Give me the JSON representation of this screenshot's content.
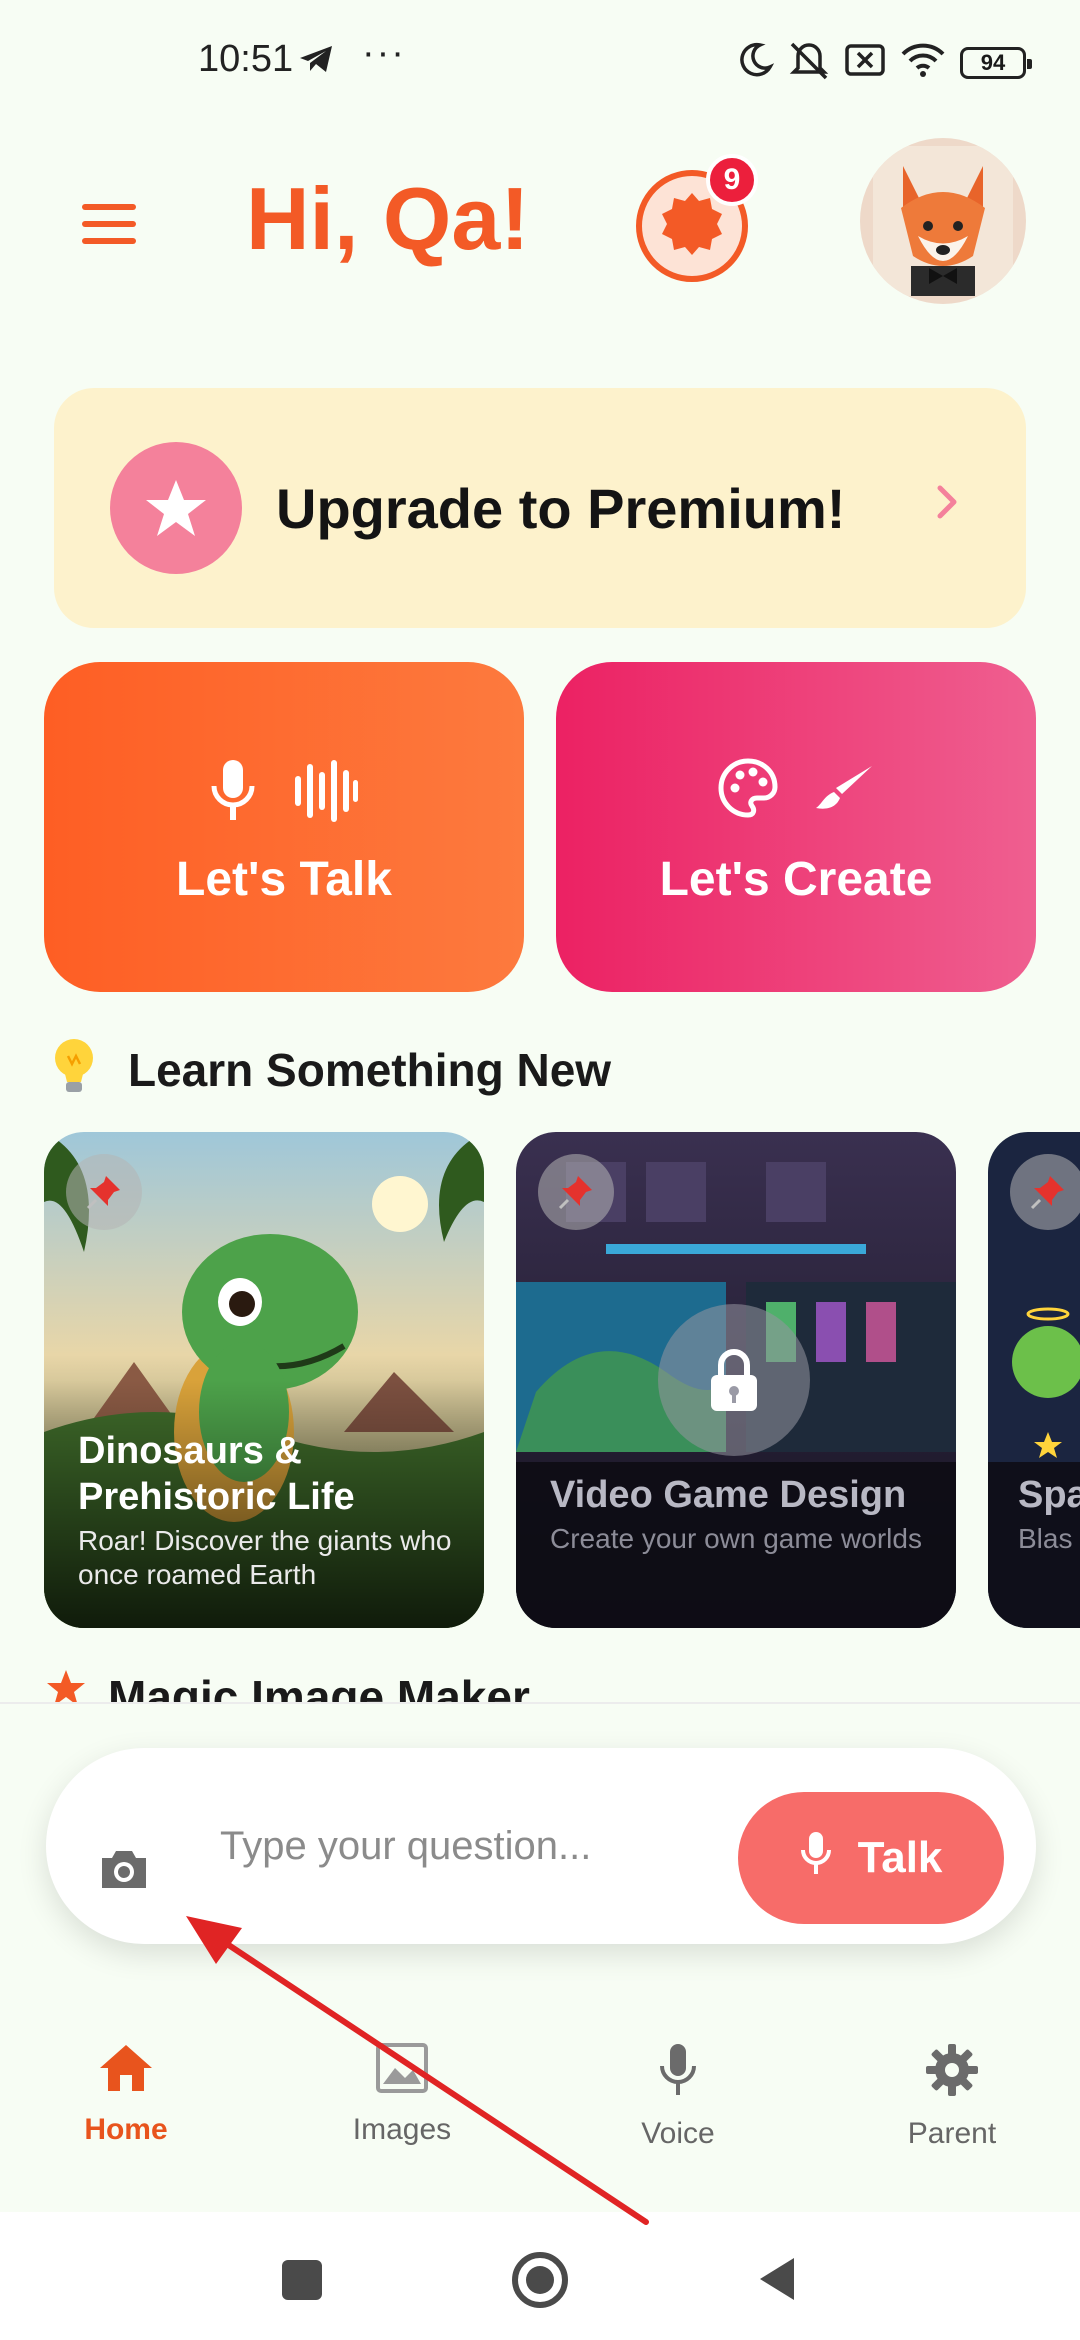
{
  "status_bar": {
    "time": "10:51",
    "dots": "···",
    "battery": "94"
  },
  "header": {
    "greeting": "Hi, Qa!",
    "notification_count": "9"
  },
  "premium": {
    "label": "Upgrade to Premium!"
  },
  "actions": {
    "talk_label": "Let's Talk",
    "create_label": "Let's Create"
  },
  "learn": {
    "title": "Learn Something New",
    "cards": [
      {
        "title": "Dinosaurs & Prehistoric Life",
        "desc": "Roar! Discover the giants who once roamed Earth"
      },
      {
        "title": "Video Game Design",
        "desc": "Create your own game worlds"
      },
      {
        "title": "Spa",
        "desc": "Blas syste"
      }
    ]
  },
  "magic": {
    "title": "Magic Image Maker"
  },
  "input": {
    "placeholder": "Type your question...",
    "talk_label": "Talk"
  },
  "nav": {
    "home": "Home",
    "images": "Images",
    "voice": "Voice",
    "parent": "Parent"
  },
  "colors": {
    "accent": "#f35a26",
    "pink": "#ec2163",
    "talk_button": "#f76c69",
    "premium_bg": "#fdf2cc"
  }
}
